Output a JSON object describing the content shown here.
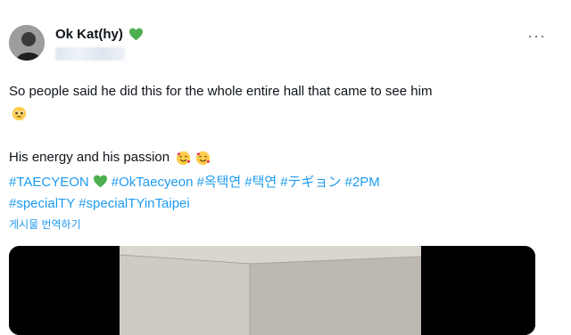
{
  "user": {
    "display_name": "Ok Kat(hy)",
    "verified_emoji": "green-heart"
  },
  "tweet": {
    "line1": "So people said he did this for the whole entire hall that came to see him",
    "line2": "His energy and his passion"
  },
  "hashtags": {
    "tag1": "#TAECYEON",
    "tag2": "#OkTaecyeon",
    "tag3": "#옥택연",
    "tag4": "#택연",
    "tag5": "#テギョン",
    "tag6": "#2PM",
    "tag7": "#specialTY",
    "tag8": "#specialTYinTaipei"
  },
  "translate_label": "게시물 번역하기",
  "more_glyph": "···",
  "colors": {
    "link": "#1d9bf0",
    "text": "#0f1419",
    "heart": "#4caf50"
  }
}
